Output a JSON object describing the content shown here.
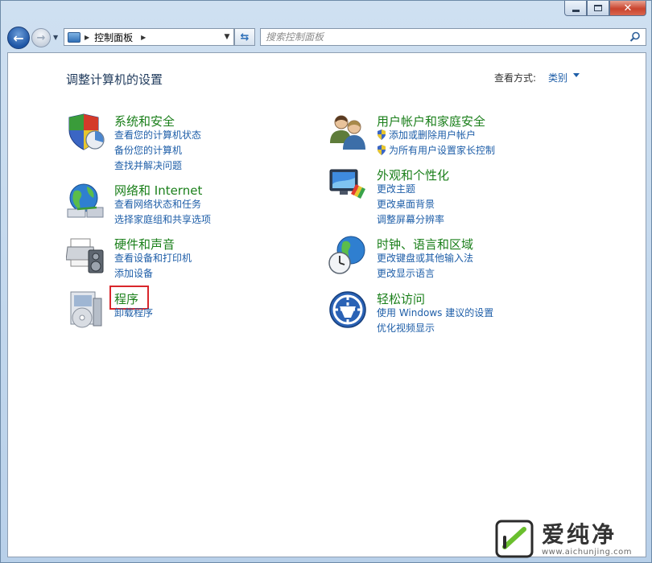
{
  "window": {
    "minimize_label": "▭",
    "maximize_label": "□",
    "close_label": "✕"
  },
  "address": {
    "path": "控制面板"
  },
  "search": {
    "placeholder": "搜索控制面板"
  },
  "header": {
    "title": "调整计算机的设置",
    "view_by_label": "查看方式:",
    "view_by_value": "类别"
  },
  "categories": {
    "system": {
      "title": "系统和安全",
      "links": [
        "查看您的计算机状态",
        "备份您的计算机",
        "查找并解决问题"
      ]
    },
    "network": {
      "title": "网络和 Internet",
      "links": [
        "查看网络状态和任务",
        "选择家庭组和共享选项"
      ]
    },
    "hardware": {
      "title": "硬件和声音",
      "links": [
        "查看设备和打印机",
        "添加设备"
      ]
    },
    "programs": {
      "title": "程序",
      "links": [
        "卸载程序"
      ]
    },
    "users": {
      "title": "用户帐户和家庭安全",
      "links": [
        "添加或删除用户帐户",
        "为所有用户设置家长控制"
      ]
    },
    "appearance": {
      "title": "外观和个性化",
      "links": [
        "更改主题",
        "更改桌面背景",
        "调整屏幕分辨率"
      ]
    },
    "clock": {
      "title": "时钟、语言和区域",
      "links": [
        "更改键盘或其他输入法",
        "更改显示语言"
      ]
    },
    "ease": {
      "title": "轻松访问",
      "links": [
        "使用 Windows 建议的设置",
        "优化视频显示"
      ]
    }
  },
  "watermark": {
    "brand": "爱纯净",
    "url": "www.aichunjing.com"
  },
  "colors": {
    "category_title": "#1a7f1a",
    "link": "#1e5ea8",
    "highlight": "#d9262b"
  }
}
